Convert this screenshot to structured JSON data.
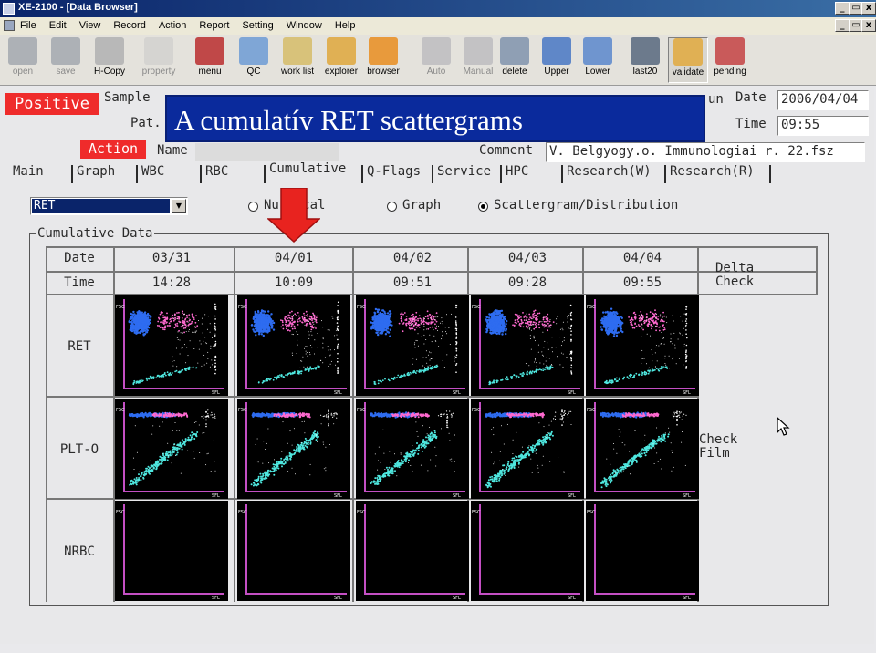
{
  "window": {
    "title": "XE-2100 - [Data Browser]",
    "controls": [
      "_",
      "ı",
      "x"
    ]
  },
  "menu": [
    "File",
    "Edit",
    "View",
    "Record",
    "Action",
    "Report",
    "Setting",
    "Window",
    "Help"
  ],
  "toolbar": [
    {
      "label": "open",
      "icon": "open-icon",
      "enabled": false
    },
    {
      "label": "save",
      "icon": "save-icon",
      "enabled": false
    },
    {
      "label": "H-Copy",
      "icon": "printer-icon",
      "enabled": true
    },
    {
      "label": "property",
      "icon": "property-icon",
      "enabled": false
    },
    {
      "label": "menu",
      "icon": "menu-icon",
      "enabled": true
    },
    {
      "label": "QC",
      "icon": "qc-icon",
      "enabled": true
    },
    {
      "label": "work list",
      "icon": "work-list-icon",
      "enabled": true
    },
    {
      "label": "explorer",
      "icon": "explorer-icon",
      "enabled": true
    },
    {
      "label": "browser",
      "icon": "browser-icon",
      "enabled": true
    },
    {
      "label": "Auto",
      "icon": "auto-icon",
      "enabled": false
    },
    {
      "label": "Manual",
      "icon": "manual-icon",
      "enabled": false
    },
    {
      "label": "delete",
      "icon": "delete-icon",
      "enabled": true
    },
    {
      "label": "Upper",
      "icon": "upper-icon",
      "enabled": true
    },
    {
      "label": "Lower",
      "icon": "lower-icon",
      "enabled": true
    },
    {
      "label": "last20",
      "icon": "last20-icon",
      "enabled": true
    },
    {
      "label": "validate",
      "icon": "validate-icon",
      "enabled": true
    },
    {
      "label": "pending",
      "icon": "pending-icon",
      "enabled": true
    }
  ],
  "header": {
    "positive": "Positive",
    "action": "Action",
    "sample_label": "Sample",
    "pat_label": "Pat.",
    "name_label": "Name",
    "comment_label": "Comment",
    "comment_value": "V. Belgyogy.o. Immunologiai r. 22.fsz",
    "run_label": "un",
    "date_label": "Date",
    "date_value": "2006/04/04",
    "time_label": "Time",
    "time_value": "09:55"
  },
  "tabs": [
    "Main",
    "Graph",
    "WBC",
    "RBC",
    "Cumulative",
    "Q-Flags",
    "Service",
    "HPC",
    "Research(W)",
    "Research(R)"
  ],
  "active_tab": "Cumulative",
  "filter": {
    "selected": "RET",
    "options": [
      "Numerical",
      "Graph",
      "Scattergram/Distribution"
    ],
    "checked": "Scattergram/Distribution",
    "numerical_display": "Nu  rical"
  },
  "cumulative": {
    "title": "Cumulative Data",
    "date_label": "Date",
    "time_label": "Time",
    "columns": [
      {
        "date": "03/31",
        "time": "14:28"
      },
      {
        "date": "04/01",
        "time": "10:09"
      },
      {
        "date": "04/02",
        "time": "09:51"
      },
      {
        "date": "04/03",
        "time": "09:28"
      },
      {
        "date": "04/04",
        "time": "09:55"
      }
    ],
    "rows": [
      "RET",
      "PLT-O",
      "NRBC"
    ],
    "delta_check": "Delta\nCheck",
    "check_film": "Check\nFilm",
    "axis_y": "FSC",
    "axis_x": "SFL"
  },
  "overlay_title": "A cumulatív RET scattergrams",
  "colors": {
    "title_bar": "#0a246a",
    "highlight_red": "#ef2b2b",
    "overlay_blue": "#0a2a9c",
    "frame_magenta": "#c44fc4",
    "dot_blue": "#2e6cf0",
    "dot_pink": "#ff6ad0",
    "dot_cyan": "#4fe8e0"
  }
}
